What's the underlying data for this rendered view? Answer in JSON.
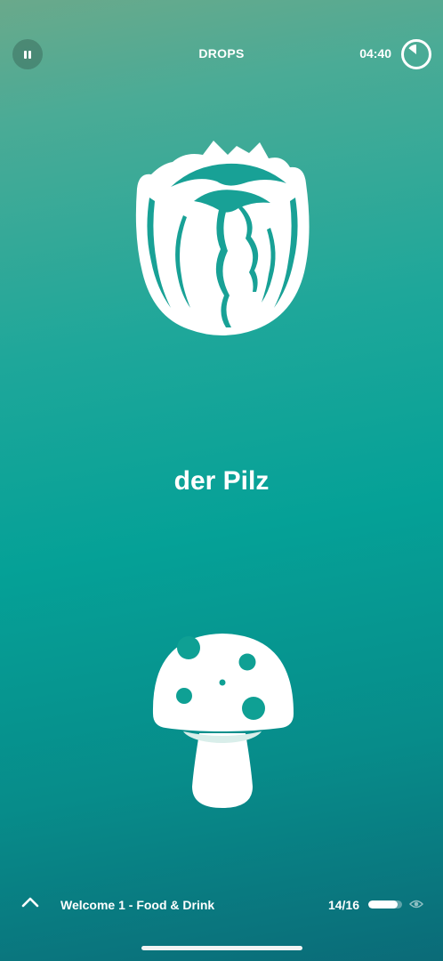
{
  "header": {
    "title": "DROPS",
    "timer": "04:40",
    "pause_icon": "pause-icon",
    "timer_icon": "timer-ring-icon"
  },
  "card": {
    "prompt_image": "cabbage-illustration",
    "word": "der Pilz",
    "answer_image": "mushroom-illustration"
  },
  "footer": {
    "expand_icon": "chevron-up-icon",
    "lesson": "Welcome 1 - Food & Drink",
    "progress_text": "14/16",
    "progress_fraction": 0.875,
    "visibility_icon": "eye-icon"
  },
  "colors": {
    "background_top": "#6aa98b",
    "background_mid": "#05a197",
    "background_bottom": "#0b6b78",
    "foreground": "#ffffff"
  }
}
